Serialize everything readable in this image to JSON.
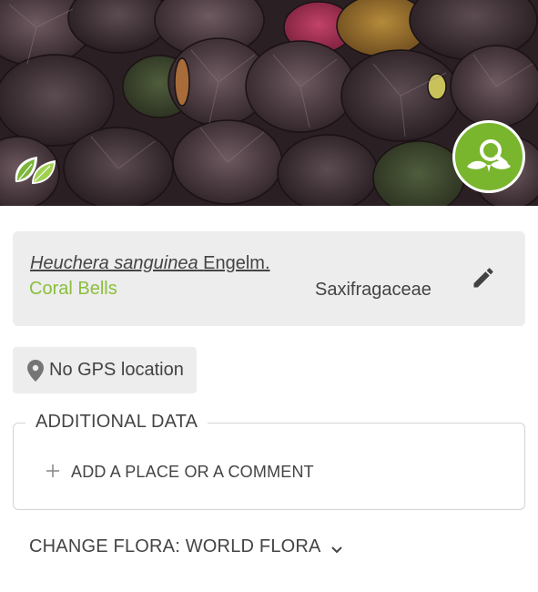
{
  "photo": {
    "description_icon_left": "leaf-badge-icon",
    "identify_button_icon": "plant-search-icon",
    "identify_button_color": "#79b62e"
  },
  "species": {
    "scientific_name": "Heuchera sanguinea",
    "author": "Engelm.",
    "common_name": "Coral Bells",
    "family": "Saxifragaceae",
    "common_name_color": "#8bbf3b",
    "edit_icon": "pencil-icon"
  },
  "location": {
    "label": "No GPS location",
    "icon": "location-pin-icon"
  },
  "additional": {
    "title": "ADDITIONAL DATA",
    "add_label": "ADD A PLACE OR A COMMENT",
    "add_icon": "plus-icon"
  },
  "flora": {
    "label": "CHANGE FLORA: WORLD FLORA",
    "icon": "chevron-down-icon"
  }
}
